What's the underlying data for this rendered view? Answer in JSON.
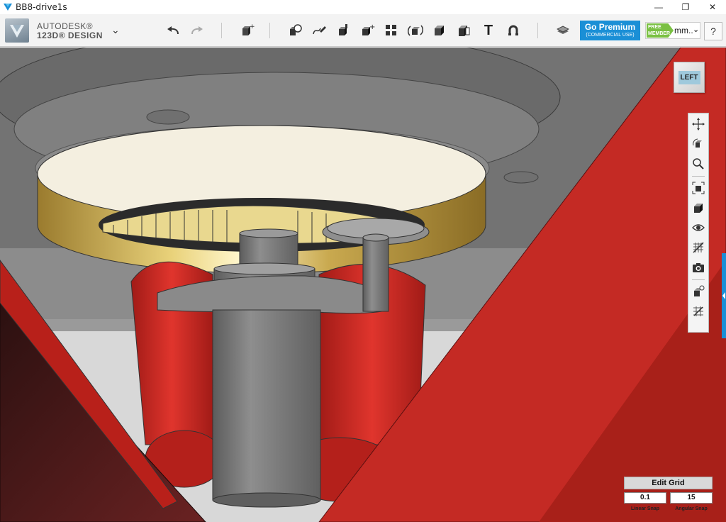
{
  "window": {
    "title": "BB8-drive1s",
    "controls": {
      "minimize": "—",
      "restore": "❐",
      "close": "✕"
    }
  },
  "toolbar": {
    "brand_line1": "AUTODESK®",
    "brand_line2": "123D® DESIGN",
    "menu_glyph": "⌄",
    "icons": [
      "undo-icon",
      "redo-icon",
      "primitives-icon",
      "sketch-icon",
      "construct-icon",
      "modify-icon",
      "pattern-icon",
      "grouping-icon",
      "combine-icon",
      "measure-icon",
      "text-icon",
      "snap-icon",
      "material-icon"
    ],
    "text_tool_glyph": "T"
  },
  "premium": {
    "label": "Go Premium",
    "sublabel": "(COMMERCIAL USE)"
  },
  "membership": {
    "badge": "FREE MEMBER",
    "units": "mm..",
    "dropdown_glyph": "⌄"
  },
  "help_label": "?",
  "viewcube": {
    "face": "LEFT"
  },
  "navbar": {
    "icons": [
      "pan-icon",
      "orbit-icon",
      "zoom-icon",
      "fit-icon",
      "view-mode-icon",
      "visibility-icon",
      "grid-toggle-icon",
      "camera-icon",
      "material-settings-icon",
      "outline-icon"
    ]
  },
  "edit_grid": {
    "title": "Edit Grid",
    "linear_snap_value": "0.1",
    "angular_snap_value": "15",
    "linear_snap_label": "Linear Snap",
    "angular_snap_label": "Angular Snap"
  },
  "colors": {
    "accent_blue": "#1a8fd6",
    "member_green": "#7ac043",
    "model_red": "#c42a24",
    "model_gold": "#c9a94f",
    "model_gray": "#7c7c7c"
  }
}
